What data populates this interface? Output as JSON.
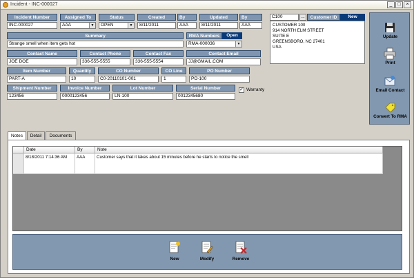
{
  "window": {
    "title": "Incident - INC-000027",
    "controls": {
      "minimize": "_",
      "maximize": "□",
      "close": "×"
    }
  },
  "row1": {
    "incident_number_label": "Incident Number",
    "incident_number": "INC-000027",
    "assigned_to_label": "Assigned To",
    "assigned_to": "AAA",
    "status_label": "Status",
    "status": "OPEN",
    "created_label": "Created",
    "created_date": "8/11/2011",
    "created_by_label": "By",
    "created_by": "AAA",
    "updated_label": "Updated",
    "updated_date": "8/11/2011",
    "updated_by_label": "By",
    "updated_by": "AAA"
  },
  "customer": {
    "customer_code": "C100",
    "lookup_button": "...",
    "customer_id_label": "Customer ID",
    "new_badge": "New",
    "address_lines": [
      "CUSTOMER 100",
      "914 NORTH ELM STREET",
      "SUITE E",
      "GREENSBORO, NC 27401",
      "USA"
    ]
  },
  "row2": {
    "summary_label": "Summary",
    "summary": "Strange smell when item gets hot",
    "rma_label": "RMA Numbers",
    "rma_status": "Open",
    "rma_number": "RMA-000036"
  },
  "row3": {
    "contact_name_label": "Contact Name",
    "contact_name": "JOE DOE",
    "contact_phone_label": "Contact Phone",
    "contact_phone": "336-555-5555",
    "contact_fax_label": "Contact Fax",
    "contact_fax": "336-555-5554",
    "contact_email_label": "Contact Email",
    "contact_email": "JJ@GMAIL.COM"
  },
  "row4": {
    "item_number_label": "Item Number",
    "item_number": "PART-A",
    "quantity_label": "Quantity",
    "quantity": "10",
    "co_number_label": "CO Number",
    "co_number": "C0-20110101-001",
    "co_line_label": "CO Line",
    "co_line": "1",
    "po_number_label": "PO Number",
    "po_number": "PO-100"
  },
  "row5": {
    "shipment_number_label": "Shipment Number",
    "shipment_number": "123456",
    "invoice_number_label": "Invoice Number",
    "invoice_number": "0000123456",
    "lot_number_label": "Lot Number",
    "lot_number": "LN-100",
    "serial_number_label": "Serial Number",
    "serial_number": "0012345680",
    "warranty_label": "Warranty",
    "warranty_checked": true
  },
  "sidebar": {
    "update": "Update",
    "print": "Print",
    "email_contact": "Email Contact",
    "convert_to_rma": "Convert To RMA"
  },
  "tabs": [
    "Notes",
    "Detail",
    "Documents"
  ],
  "notes_grid": {
    "columns": [
      "Date",
      "By",
      "Note"
    ],
    "rows": [
      {
        "date": "8/18/2011 7:14:36 AM",
        "by": "AAA",
        "note": "Customer says that it takes about 15 minutes before he starts to notice the smell"
      }
    ]
  },
  "actions": {
    "new": "New",
    "modify": "Modify",
    "remove": "Remove"
  },
  "colors": {
    "header_blue": "#8096b0",
    "badge_navy": "#0a3a78",
    "panel_blue": "#8298b0"
  }
}
